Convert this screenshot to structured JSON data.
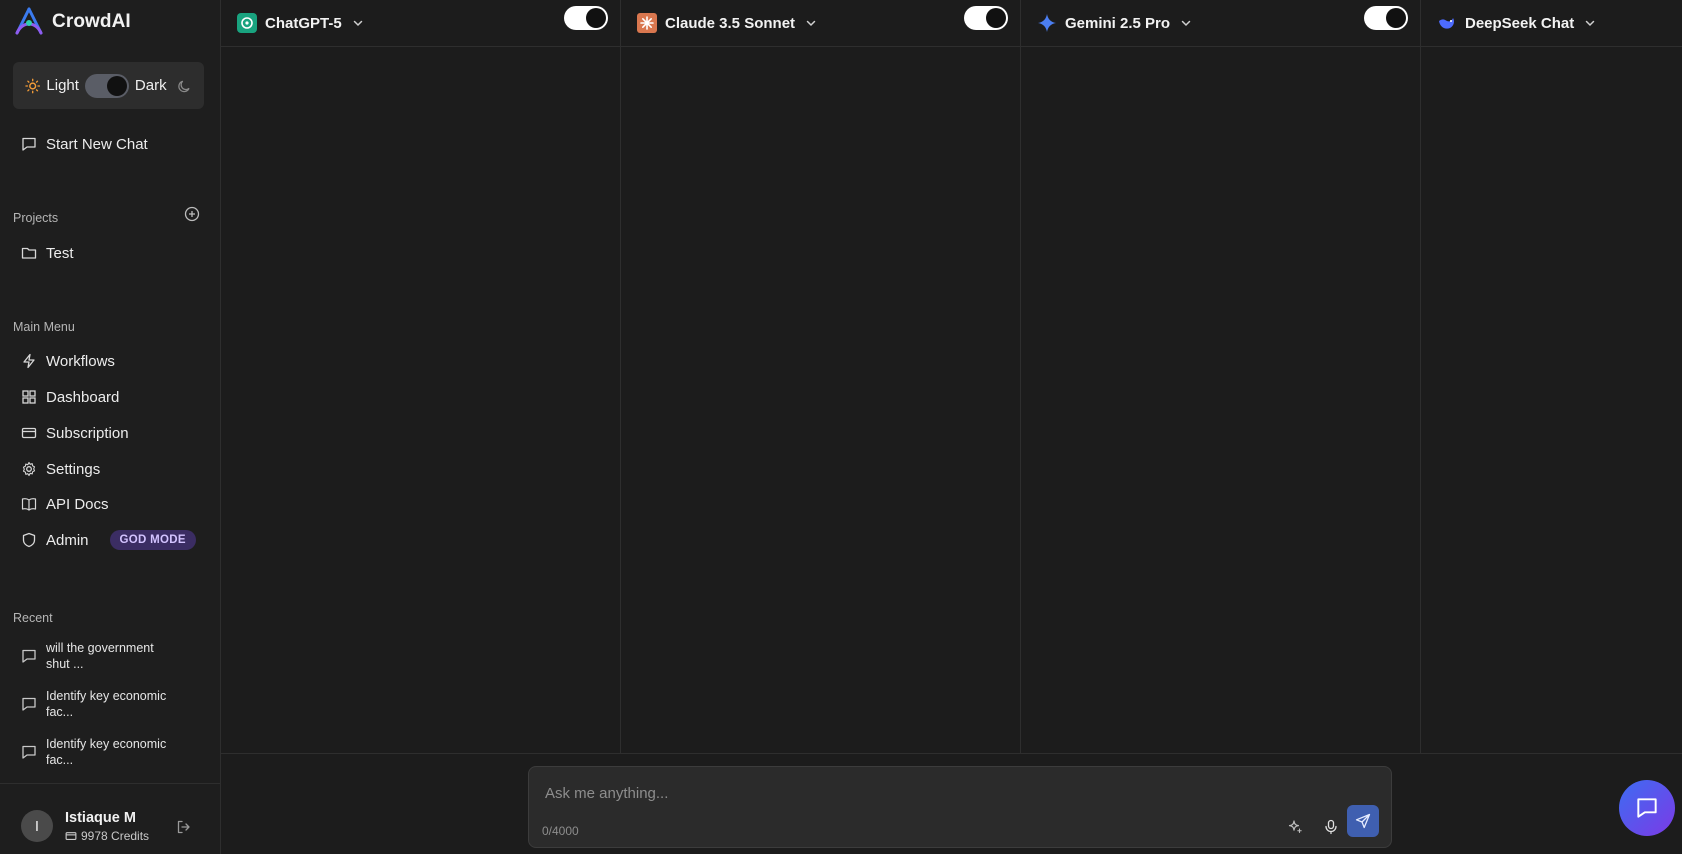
{
  "app": {
    "name": "CrowdAI"
  },
  "theme": {
    "light_label": "Light",
    "dark_label": "Dark",
    "mode": "dark"
  },
  "sidebar": {
    "new_chat": "Start New Chat",
    "projects": {
      "title": "Projects",
      "items": [
        {
          "label": "Test"
        }
      ]
    },
    "main_menu": {
      "title": "Main Menu",
      "items": [
        {
          "label": "Workflows",
          "icon": "zap-icon"
        },
        {
          "label": "Dashboard",
          "icon": "grid-icon"
        },
        {
          "label": "Subscription",
          "icon": "credit-card-icon"
        },
        {
          "label": "Settings",
          "icon": "gear-icon"
        },
        {
          "label": "API Docs",
          "icon": "book-icon"
        },
        {
          "label": "Admin",
          "icon": "shield-icon",
          "badge": "GOD MODE"
        }
      ]
    },
    "recent": {
      "title": "Recent",
      "items": [
        {
          "line1": "will the government",
          "line2": "shut ..."
        },
        {
          "line1": "Identify key economic",
          "line2": "fac..."
        },
        {
          "line1": "Identify key economic",
          "line2": "fac..."
        }
      ]
    }
  },
  "user": {
    "initial": "I",
    "name": "Istiaque M",
    "credits": "9978 Credits"
  },
  "models": [
    {
      "name": "ChatGPT-5",
      "icon": "openai-icon",
      "enabled": true
    },
    {
      "name": "Claude 3.5 Sonnet",
      "icon": "claude-icon",
      "enabled": true
    },
    {
      "name": "Gemini 2.5 Pro",
      "icon": "gemini-icon",
      "enabled": true
    },
    {
      "name": "DeepSeek Chat",
      "icon": "deepseek-icon",
      "enabled": true
    }
  ],
  "composer": {
    "placeholder": "Ask me anything...",
    "counter": "0/4000"
  },
  "colors": {
    "accent": "#3f5fb0",
    "badge_bg": "#3b2d63",
    "badge_text": "#d3c3ff",
    "fab_from": "#3d6cf2",
    "fab_to": "#7c3ae6"
  }
}
